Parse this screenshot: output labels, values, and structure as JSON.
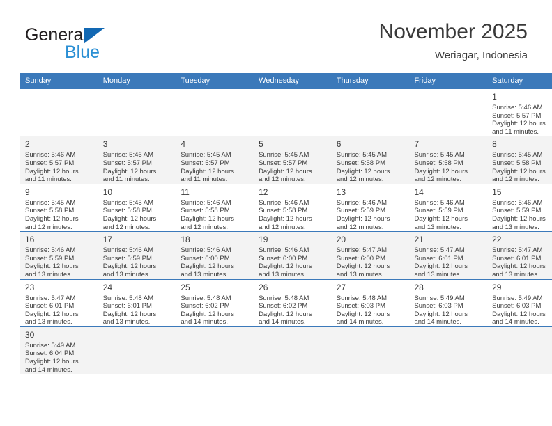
{
  "brand": {
    "name_top": "General",
    "name_bottom": "Blue",
    "accent_color": "#1268b3",
    "accent_color_light": "#2a8fd4"
  },
  "header": {
    "title": "November 2025",
    "subtitle": "Weriagar, Indonesia"
  },
  "theme": {
    "header_row_bg": "#3b79ba",
    "row_divider": "#3b79ba",
    "alt_row_bg": "#f3f3f3",
    "text": "#3a3a3a"
  },
  "weekdays": [
    {
      "label": "Sunday"
    },
    {
      "label": "Monday"
    },
    {
      "label": "Tuesday"
    },
    {
      "label": "Wednesday"
    },
    {
      "label": "Thursday"
    },
    {
      "label": "Friday"
    },
    {
      "label": "Saturday"
    }
  ],
  "weeks": [
    {
      "alt": false,
      "days": [
        {
          "num": "",
          "sunrise": "",
          "sunset": "",
          "daylight_l1": "",
          "daylight_l2": "",
          "empty": true
        },
        {
          "num": "",
          "sunrise": "",
          "sunset": "",
          "daylight_l1": "",
          "daylight_l2": "",
          "empty": true
        },
        {
          "num": "",
          "sunrise": "",
          "sunset": "",
          "daylight_l1": "",
          "daylight_l2": "",
          "empty": true
        },
        {
          "num": "",
          "sunrise": "",
          "sunset": "",
          "daylight_l1": "",
          "daylight_l2": "",
          "empty": true
        },
        {
          "num": "",
          "sunrise": "",
          "sunset": "",
          "daylight_l1": "",
          "daylight_l2": "",
          "empty": true
        },
        {
          "num": "",
          "sunrise": "",
          "sunset": "",
          "daylight_l1": "",
          "daylight_l2": "",
          "empty": true
        },
        {
          "num": "1",
          "sunrise": "Sunrise: 5:46 AM",
          "sunset": "Sunset: 5:57 PM",
          "daylight_l1": "Daylight: 12 hours",
          "daylight_l2": "and 11 minutes.",
          "empty": false
        }
      ]
    },
    {
      "alt": true,
      "days": [
        {
          "num": "2",
          "sunrise": "Sunrise: 5:46 AM",
          "sunset": "Sunset: 5:57 PM",
          "daylight_l1": "Daylight: 12 hours",
          "daylight_l2": "and 11 minutes.",
          "empty": false
        },
        {
          "num": "3",
          "sunrise": "Sunrise: 5:46 AM",
          "sunset": "Sunset: 5:57 PM",
          "daylight_l1": "Daylight: 12 hours",
          "daylight_l2": "and 11 minutes.",
          "empty": false
        },
        {
          "num": "4",
          "sunrise": "Sunrise: 5:45 AM",
          "sunset": "Sunset: 5:57 PM",
          "daylight_l1": "Daylight: 12 hours",
          "daylight_l2": "and 11 minutes.",
          "empty": false
        },
        {
          "num": "5",
          "sunrise": "Sunrise: 5:45 AM",
          "sunset": "Sunset: 5:57 PM",
          "daylight_l1": "Daylight: 12 hours",
          "daylight_l2": "and 12 minutes.",
          "empty": false
        },
        {
          "num": "6",
          "sunrise": "Sunrise: 5:45 AM",
          "sunset": "Sunset: 5:58 PM",
          "daylight_l1": "Daylight: 12 hours",
          "daylight_l2": "and 12 minutes.",
          "empty": false
        },
        {
          "num": "7",
          "sunrise": "Sunrise: 5:45 AM",
          "sunset": "Sunset: 5:58 PM",
          "daylight_l1": "Daylight: 12 hours",
          "daylight_l2": "and 12 minutes.",
          "empty": false
        },
        {
          "num": "8",
          "sunrise": "Sunrise: 5:45 AM",
          "sunset": "Sunset: 5:58 PM",
          "daylight_l1": "Daylight: 12 hours",
          "daylight_l2": "and 12 minutes.",
          "empty": false
        }
      ]
    },
    {
      "alt": false,
      "days": [
        {
          "num": "9",
          "sunrise": "Sunrise: 5:45 AM",
          "sunset": "Sunset: 5:58 PM",
          "daylight_l1": "Daylight: 12 hours",
          "daylight_l2": "and 12 minutes.",
          "empty": false
        },
        {
          "num": "10",
          "sunrise": "Sunrise: 5:45 AM",
          "sunset": "Sunset: 5:58 PM",
          "daylight_l1": "Daylight: 12 hours",
          "daylight_l2": "and 12 minutes.",
          "empty": false
        },
        {
          "num": "11",
          "sunrise": "Sunrise: 5:46 AM",
          "sunset": "Sunset: 5:58 PM",
          "daylight_l1": "Daylight: 12 hours",
          "daylight_l2": "and 12 minutes.",
          "empty": false
        },
        {
          "num": "12",
          "sunrise": "Sunrise: 5:46 AM",
          "sunset": "Sunset: 5:58 PM",
          "daylight_l1": "Daylight: 12 hours",
          "daylight_l2": "and 12 minutes.",
          "empty": false
        },
        {
          "num": "13",
          "sunrise": "Sunrise: 5:46 AM",
          "sunset": "Sunset: 5:59 PM",
          "daylight_l1": "Daylight: 12 hours",
          "daylight_l2": "and 12 minutes.",
          "empty": false
        },
        {
          "num": "14",
          "sunrise": "Sunrise: 5:46 AM",
          "sunset": "Sunset: 5:59 PM",
          "daylight_l1": "Daylight: 12 hours",
          "daylight_l2": "and 13 minutes.",
          "empty": false
        },
        {
          "num": "15",
          "sunrise": "Sunrise: 5:46 AM",
          "sunset": "Sunset: 5:59 PM",
          "daylight_l1": "Daylight: 12 hours",
          "daylight_l2": "and 13 minutes.",
          "empty": false
        }
      ]
    },
    {
      "alt": true,
      "days": [
        {
          "num": "16",
          "sunrise": "Sunrise: 5:46 AM",
          "sunset": "Sunset: 5:59 PM",
          "daylight_l1": "Daylight: 12 hours",
          "daylight_l2": "and 13 minutes.",
          "empty": false
        },
        {
          "num": "17",
          "sunrise": "Sunrise: 5:46 AM",
          "sunset": "Sunset: 5:59 PM",
          "daylight_l1": "Daylight: 12 hours",
          "daylight_l2": "and 13 minutes.",
          "empty": false
        },
        {
          "num": "18",
          "sunrise": "Sunrise: 5:46 AM",
          "sunset": "Sunset: 6:00 PM",
          "daylight_l1": "Daylight: 12 hours",
          "daylight_l2": "and 13 minutes.",
          "empty": false
        },
        {
          "num": "19",
          "sunrise": "Sunrise: 5:46 AM",
          "sunset": "Sunset: 6:00 PM",
          "daylight_l1": "Daylight: 12 hours",
          "daylight_l2": "and 13 minutes.",
          "empty": false
        },
        {
          "num": "20",
          "sunrise": "Sunrise: 5:47 AM",
          "sunset": "Sunset: 6:00 PM",
          "daylight_l1": "Daylight: 12 hours",
          "daylight_l2": "and 13 minutes.",
          "empty": false
        },
        {
          "num": "21",
          "sunrise": "Sunrise: 5:47 AM",
          "sunset": "Sunset: 6:01 PM",
          "daylight_l1": "Daylight: 12 hours",
          "daylight_l2": "and 13 minutes.",
          "empty": false
        },
        {
          "num": "22",
          "sunrise": "Sunrise: 5:47 AM",
          "sunset": "Sunset: 6:01 PM",
          "daylight_l1": "Daylight: 12 hours",
          "daylight_l2": "and 13 minutes.",
          "empty": false
        }
      ]
    },
    {
      "alt": false,
      "days": [
        {
          "num": "23",
          "sunrise": "Sunrise: 5:47 AM",
          "sunset": "Sunset: 6:01 PM",
          "daylight_l1": "Daylight: 12 hours",
          "daylight_l2": "and 13 minutes.",
          "empty": false
        },
        {
          "num": "24",
          "sunrise": "Sunrise: 5:48 AM",
          "sunset": "Sunset: 6:01 PM",
          "daylight_l1": "Daylight: 12 hours",
          "daylight_l2": "and 13 minutes.",
          "empty": false
        },
        {
          "num": "25",
          "sunrise": "Sunrise: 5:48 AM",
          "sunset": "Sunset: 6:02 PM",
          "daylight_l1": "Daylight: 12 hours",
          "daylight_l2": "and 14 minutes.",
          "empty": false
        },
        {
          "num": "26",
          "sunrise": "Sunrise: 5:48 AM",
          "sunset": "Sunset: 6:02 PM",
          "daylight_l1": "Daylight: 12 hours",
          "daylight_l2": "and 14 minutes.",
          "empty": false
        },
        {
          "num": "27",
          "sunrise": "Sunrise: 5:48 AM",
          "sunset": "Sunset: 6:03 PM",
          "daylight_l1": "Daylight: 12 hours",
          "daylight_l2": "and 14 minutes.",
          "empty": false
        },
        {
          "num": "28",
          "sunrise": "Sunrise: 5:49 AM",
          "sunset": "Sunset: 6:03 PM",
          "daylight_l1": "Daylight: 12 hours",
          "daylight_l2": "and 14 minutes.",
          "empty": false
        },
        {
          "num": "29",
          "sunrise": "Sunrise: 5:49 AM",
          "sunset": "Sunset: 6:03 PM",
          "daylight_l1": "Daylight: 12 hours",
          "daylight_l2": "and 14 minutes.",
          "empty": false
        }
      ]
    },
    {
      "alt": true,
      "days": [
        {
          "num": "30",
          "sunrise": "Sunrise: 5:49 AM",
          "sunset": "Sunset: 6:04 PM",
          "daylight_l1": "Daylight: 12 hours",
          "daylight_l2": "and 14 minutes.",
          "empty": false
        },
        {
          "num": "",
          "sunrise": "",
          "sunset": "",
          "daylight_l1": "",
          "daylight_l2": "",
          "empty": true
        },
        {
          "num": "",
          "sunrise": "",
          "sunset": "",
          "daylight_l1": "",
          "daylight_l2": "",
          "empty": true
        },
        {
          "num": "",
          "sunrise": "",
          "sunset": "",
          "daylight_l1": "",
          "daylight_l2": "",
          "empty": true
        },
        {
          "num": "",
          "sunrise": "",
          "sunset": "",
          "daylight_l1": "",
          "daylight_l2": "",
          "empty": true
        },
        {
          "num": "",
          "sunrise": "",
          "sunset": "",
          "daylight_l1": "",
          "daylight_l2": "",
          "empty": true
        },
        {
          "num": "",
          "sunrise": "",
          "sunset": "",
          "daylight_l1": "",
          "daylight_l2": "",
          "empty": true
        }
      ]
    }
  ]
}
